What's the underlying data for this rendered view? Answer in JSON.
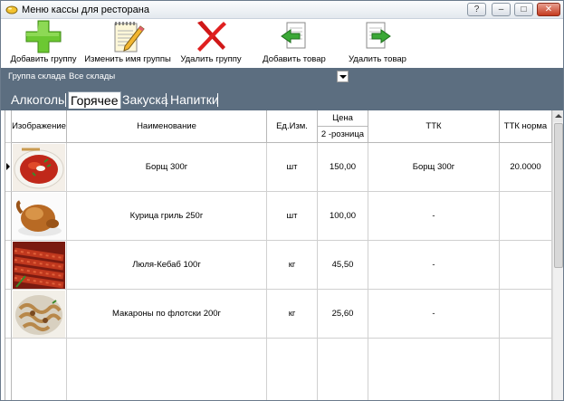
{
  "window": {
    "title": "Меню кассы для ресторана",
    "buttons": {
      "help": "?",
      "minimize": "–",
      "maximize": "□",
      "close": "✕"
    }
  },
  "toolbar": {
    "add_group": "Добавить группу",
    "rename_group": "Изменить имя группы",
    "delete_group": "Удалить группу",
    "add_item": "Добавить товар",
    "delete_item": "Удалить товар"
  },
  "filter": {
    "label": "Группа склада",
    "value": "Все склады"
  },
  "tabs": [
    {
      "label": "Алкоголь",
      "active": false
    },
    {
      "label": "Горячее",
      "active": true
    },
    {
      "label": "Закуска",
      "active": false
    },
    {
      "label": "Напитки",
      "active": false
    }
  ],
  "table": {
    "columns": {
      "image": "Изображение",
      "name": "Наименование",
      "unit": "Ед.Изм.",
      "price": "Цена",
      "price_sub": "2 -розница",
      "ttk": "ТТК",
      "ttk_norm": "ТТК норма"
    },
    "rows": [
      {
        "image": "borscht-photo",
        "name": "Борщ 300г",
        "unit": "шт",
        "price": "150,00",
        "ttk": "Борщ 300г",
        "ttk_norm": "20.0000"
      },
      {
        "image": "grilled-chicken-photo",
        "name": "Курица гриль 250г",
        "unit": "шт",
        "price": "100,00",
        "ttk": "-",
        "ttk_norm": ""
      },
      {
        "image": "lula-kebab-photo",
        "name": "Люля-Кебаб 100г",
        "unit": "кг",
        "price": "45,50",
        "ttk": "-",
        "ttk_norm": ""
      },
      {
        "image": "navy-pasta-photo",
        "name": "Макароны по флотски 200г",
        "unit": "кг",
        "price": "25,60",
        "ttk": "-",
        "ttk_norm": ""
      }
    ]
  },
  "colors": {
    "panel": "#5c6e80",
    "add_green": "#6cc832",
    "delete_red": "#d01818"
  }
}
